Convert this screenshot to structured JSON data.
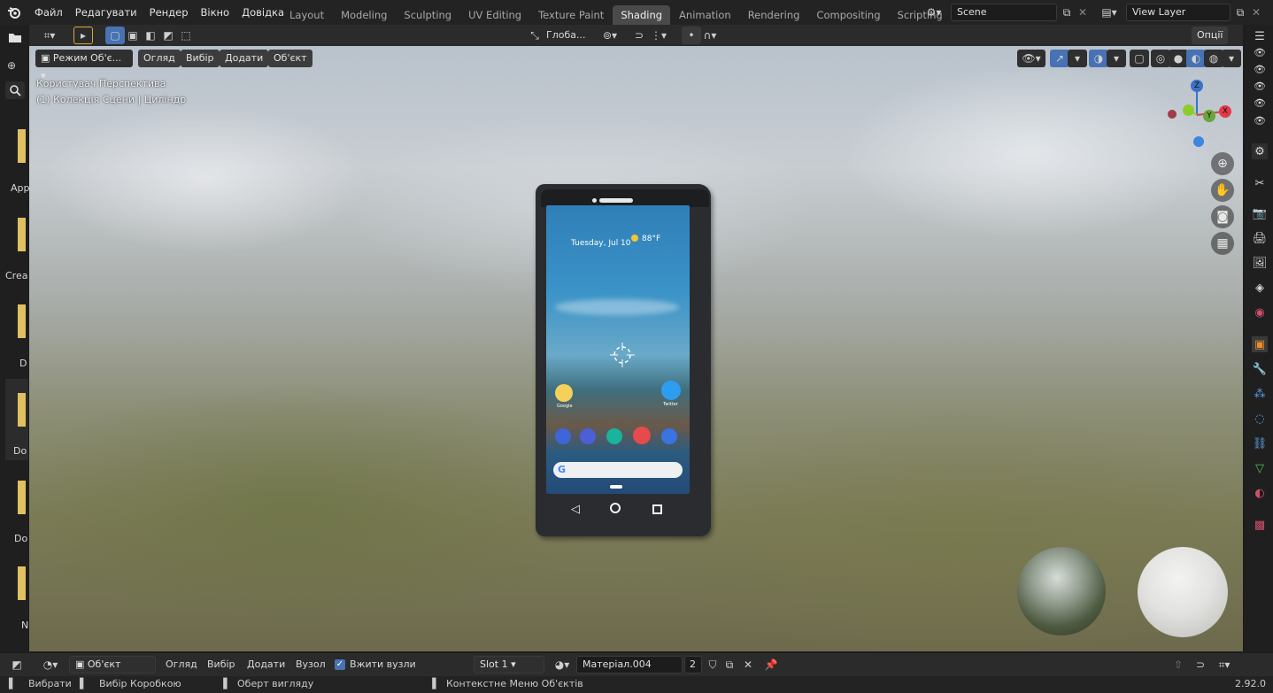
{
  "topbar": {
    "menus": [
      "Файл",
      "Редагувати",
      "Рендер",
      "Вікно",
      "Довідка"
    ],
    "workspaces": [
      "Layout",
      "Modeling",
      "Sculpting",
      "UV Editing",
      "Texture Paint",
      "Shading",
      "Animation",
      "Rendering",
      "Compositing",
      "Scripting"
    ],
    "active_workspace": "Shading",
    "scene": "Scene",
    "view_layer": "View Layer"
  },
  "viewport_header": {
    "transform_orientation": "Глоба...",
    "options": "Опції",
    "mode": "Режим Об'є...",
    "menus": [
      "Огляд",
      "Вибір",
      "Додати",
      "Об'єкт"
    ]
  },
  "viewport_overlay": {
    "view_name": "Користувач Перспектива",
    "collection_info": "(1) Колекція Сцени | Циліндр"
  },
  "gizmo": {
    "z": "Z",
    "y": "Y",
    "x": "X"
  },
  "left_panel_labels": [
    "App",
    "Crea",
    "D",
    "Do",
    "Do",
    "N"
  ],
  "phone_screen": {
    "date": "Tuesday, Jul 10",
    "temp": "88°F",
    "app_google": "Google",
    "app_twitter": "Twitter",
    "search_g": "G"
  },
  "node_header": {
    "editor_mode": "Об'єкт",
    "menus": [
      "Огляд",
      "Вибір",
      "Додати",
      "Вузол"
    ],
    "use_nodes_label": "Вжити вузли",
    "use_nodes": true,
    "slot": "Slot 1",
    "material": "Матеріал.004",
    "users": "2"
  },
  "statusbar": {
    "select": "Вибрати",
    "box_select": "Вибір Коробкою",
    "rotate_view": "Оберт вигляду",
    "context_menu": "Контекстне Меню Об'єктів",
    "version": "2.92.0"
  },
  "colors": {
    "accent": "#4772b3",
    "active_tab": "#4a4a4a",
    "x_axis": "#e13a4a",
    "y_axis": "#8ecc2b",
    "z_axis": "#3a73c7"
  }
}
